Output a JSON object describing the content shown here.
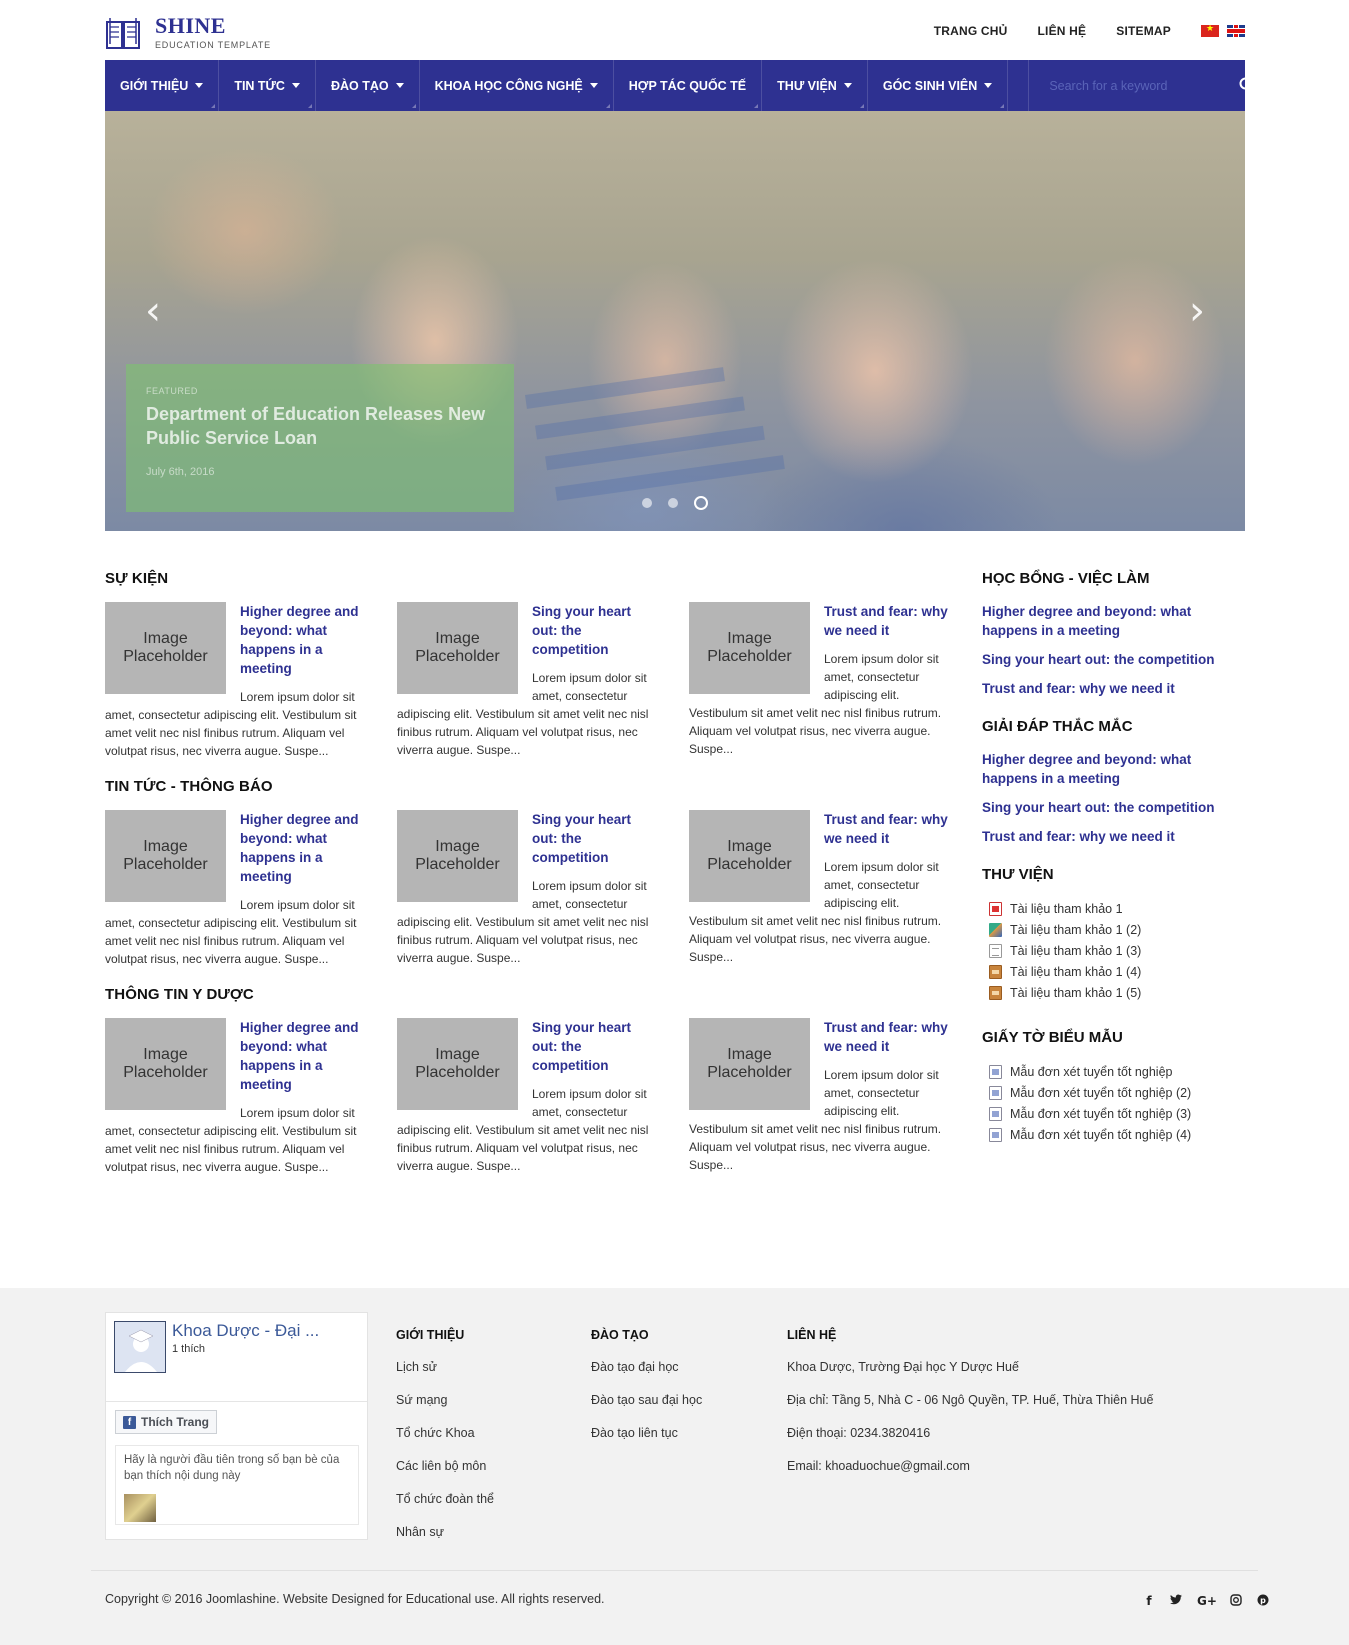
{
  "brand": {
    "name": "SHINE",
    "tagline": "EDUCATION TEMPLATE"
  },
  "top_links": [
    "TRANG CHỦ",
    "LIÊN HỆ",
    "SITEMAP"
  ],
  "nav": {
    "items": [
      {
        "label": "GIỚI THIỆU",
        "has_dropdown": true
      },
      {
        "label": "TIN TỨC",
        "has_dropdown": true
      },
      {
        "label": "ĐÀO TẠO",
        "has_dropdown": true
      },
      {
        "label": "KHOA HỌC CÔNG NGHỆ",
        "has_dropdown": true
      },
      {
        "label": "HỢP TÁC QUỐC TẾ",
        "has_dropdown": false
      },
      {
        "label": "THƯ VIỆN",
        "has_dropdown": true
      },
      {
        "label": "GÓC SINH VIÊN",
        "has_dropdown": true
      }
    ],
    "search_placeholder": "Search for a keyword"
  },
  "slider": {
    "label": "FEATURED",
    "title": "Department of Education Releases New Public Service Loan",
    "date": "July 6th, 2016",
    "dot_count": 3,
    "active_dot": 3
  },
  "placeholder_text": "Image Placeholder",
  "sections": [
    {
      "title": "SỰ KIỆN",
      "cards": [
        {
          "title": "Higher degree and beyond: what happens in a meeting",
          "text": "Lorem ipsum dolor sit amet, consectetur adipiscing elit. Vestibulum sit amet velit nec nisl finibus rutrum. Aliquam vel volutpat risus, nec viverra augue. Suspe..."
        },
        {
          "title": "Sing your heart out: the competition",
          "text": "Lorem ipsum dolor sit amet, consectetur adipiscing elit. Vestibulum sit amet velit nec nisl finibus rutrum. Aliquam vel volutpat risus, nec viverra augue. Suspe..."
        },
        {
          "title": "Trust and fear: why we need it",
          "text": "Lorem ipsum dolor sit amet, consectetur adipiscing elit. Vestibulum sit amet velit nec nisl finibus rutrum. Aliquam vel volutpat risus, nec viverra augue. Suspe..."
        }
      ]
    },
    {
      "title": "TIN TỨC - THÔNG BÁO",
      "cards": [
        {
          "title": "Higher degree and beyond: what happens in a meeting",
          "text": "Lorem ipsum dolor sit amet, consectetur adipiscing elit. Vestibulum sit amet velit nec nisl finibus rutrum. Aliquam vel volutpat risus, nec viverra augue. Suspe..."
        },
        {
          "title": "Sing your heart out: the competition",
          "text": "Lorem ipsum dolor sit amet, consectetur adipiscing elit. Vestibulum sit amet velit nec nisl finibus rutrum. Aliquam vel volutpat risus, nec viverra augue. Suspe..."
        },
        {
          "title": "Trust and fear: why we need it",
          "text": "Lorem ipsum dolor sit amet, consectetur adipiscing elit. Vestibulum sit amet velit nec nisl finibus rutrum. Aliquam vel volutpat risus, nec viverra augue. Suspe..."
        }
      ]
    },
    {
      "title": "THÔNG TIN Y DƯỢC",
      "cards": [
        {
          "title": "Higher degree and beyond: what happens in a meeting",
          "text": "Lorem ipsum dolor sit amet, consectetur adipiscing elit. Vestibulum sit amet velit nec nisl finibus rutrum. Aliquam vel volutpat risus, nec viverra augue. Suspe..."
        },
        {
          "title": "Sing your heart out: the competition",
          "text": "Lorem ipsum dolor sit amet, consectetur adipiscing elit. Vestibulum sit amet velit nec nisl finibus rutrum. Aliquam vel volutpat risus, nec viverra augue. Suspe..."
        },
        {
          "title": "Trust and fear: why we need it",
          "text": "Lorem ipsum dolor sit amet, consectetur adipiscing elit. Vestibulum sit amet velit nec nisl finibus rutrum. Aliquam vel volutpat risus, nec viverra augue. Suspe..."
        }
      ]
    }
  ],
  "sidebar": {
    "scholarship": {
      "title": "HỌC BỔNG - VIỆC LÀM",
      "links": [
        "Higher degree and beyond: what happens in a meeting",
        "Sing your heart out: the competition",
        "Trust and fear: why we need it"
      ]
    },
    "faq": {
      "title": "GIẢI ĐÁP THẮC MẮC",
      "links": [
        "Higher degree and beyond: what happens in a meeting",
        "Sing your heart out: the competition",
        "Trust and fear: why we need it"
      ]
    },
    "library": {
      "title": "THƯ VIỆN",
      "items": [
        {
          "label": "Tài liệu tham khảo 1",
          "icon": "pdf-file-icon"
        },
        {
          "label": "Tài liệu tham khảo 1 (2)",
          "icon": "image-file-icon"
        },
        {
          "label": "Tài liệu tham khảo 1 (3)",
          "icon": "text-file-icon"
        },
        {
          "label": "Tài liệu tham khảo 1 (4)",
          "icon": "archive-file-icon"
        },
        {
          "label": "Tài liệu tham khảo 1 (5)",
          "icon": "archive-file-icon"
        }
      ]
    },
    "forms": {
      "title": "GIẤY TỜ BIỂU MẪU",
      "items": [
        {
          "label": "Mẫu đơn xét tuyển tốt nghiệp",
          "icon": "document-file-icon"
        },
        {
          "label": "Mẫu đơn xét tuyển tốt nghiệp (2)",
          "icon": "document-file-icon"
        },
        {
          "label": "Mẫu đơn xét tuyển tốt nghiệp (3)",
          "icon": "document-file-icon"
        },
        {
          "label": "Mẫu đơn xét tuyển tốt nghiệp (4)",
          "icon": "document-file-icon"
        }
      ]
    }
  },
  "facebook": {
    "page_name": "Khoa Dược - Đại ...",
    "likes": "1 thích",
    "like_button": "Thích Trang",
    "friends_text": "Hãy là người đầu tiên trong số bạn bè của bạn thích nội dung này"
  },
  "footer": {
    "about": {
      "title": "GIỚI THIỆU",
      "links": [
        "Lịch sử",
        "Sứ mạng",
        "Tổ chức Khoa",
        "Các liên bộ môn",
        "Tổ chức đoàn thể",
        "Nhân sự"
      ]
    },
    "training": {
      "title": "ĐÀO TẠO",
      "links": [
        "Đào tạo đại học",
        "Đào tạo sau đại học",
        "Đào tạo liên tục"
      ]
    },
    "contact": {
      "title": "LIÊN HỆ",
      "lines": [
        "Khoa Dược, Trường Đại học Y Dược Huế",
        "Địa chỉ: Tầng 5, Nhà C - 06 Ngô Quyền, TP. Huế, Thừa Thiên Huế",
        "Điện thoại: 0234.3820416",
        "Email: khoaduochue@gmail.com"
      ]
    },
    "copyright": "Copyright © 2016 Joomlashine. Website Designed for Educational use. All rights reserved.",
    "social": [
      {
        "name": "facebook-icon",
        "glyph": "f"
      },
      {
        "name": "twitter-icon",
        "glyph": "🐦"
      },
      {
        "name": "google-plus-icon",
        "glyph": "G+"
      },
      {
        "name": "instagram-icon",
        "glyph": "◎"
      },
      {
        "name": "pinterest-icon",
        "glyph": "℗"
      }
    ]
  },
  "colors": {
    "primary": "#2e3191",
    "link": "#2e3191",
    "footer_bg": "#f2f2f2",
    "caption_bg": "#7dc36e"
  }
}
